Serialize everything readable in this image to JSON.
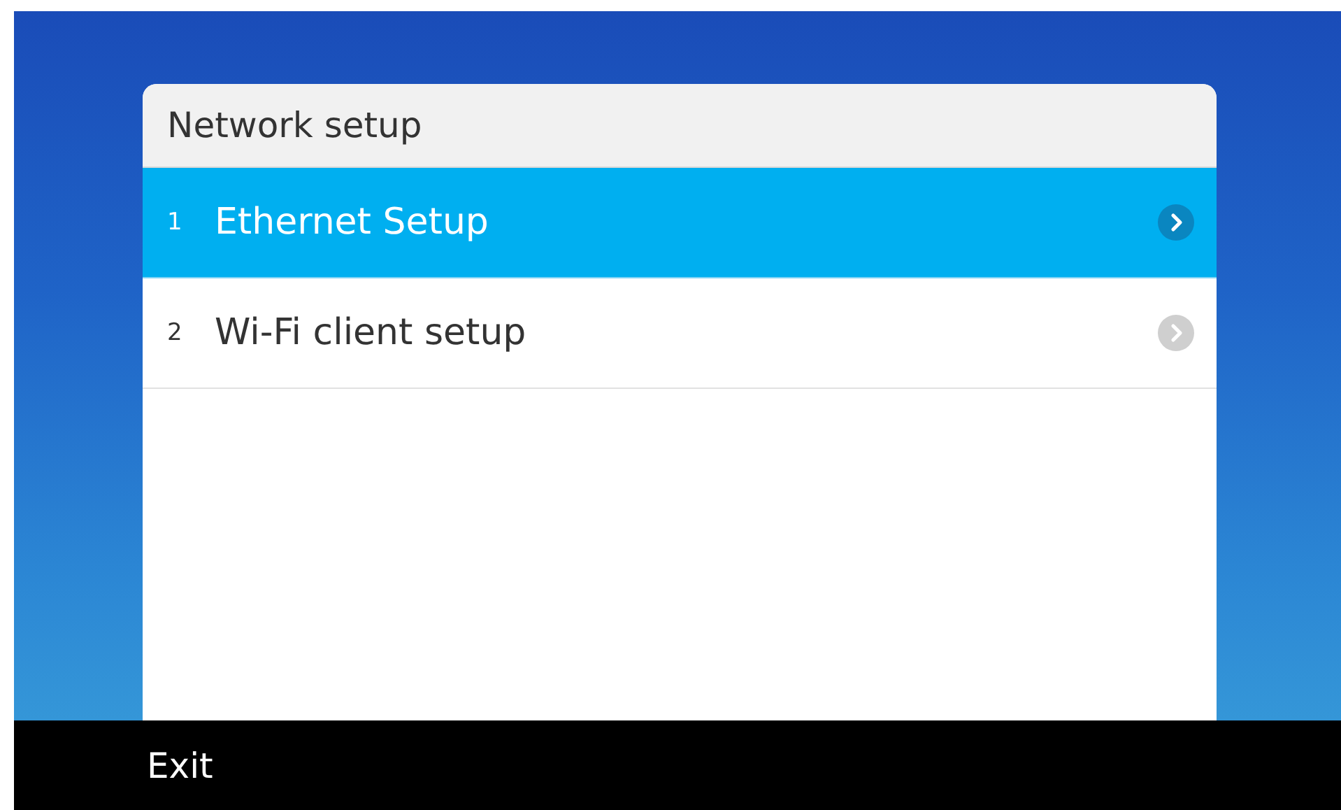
{
  "dialog": {
    "title": "Network setup",
    "items": [
      {
        "number": "1",
        "label": "Ethernet Setup",
        "selected": true
      },
      {
        "number": "2",
        "label": "Wi-Fi client setup",
        "selected": false
      }
    ]
  },
  "softkeys": [
    {
      "label": "Exit"
    }
  ]
}
